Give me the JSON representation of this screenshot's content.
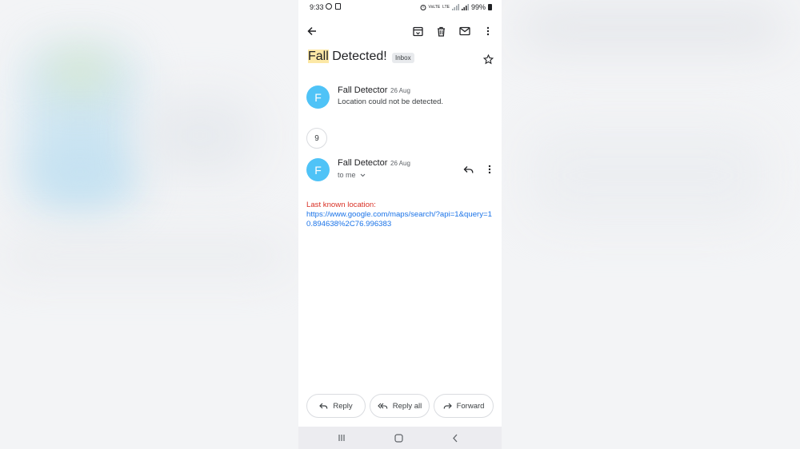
{
  "status_bar": {
    "time": "9:33",
    "battery": "99%",
    "signal_text_1": "VoLTE",
    "signal_text_2": "LTE"
  },
  "toolbar": {
    "back_icon": "arrow-left-icon",
    "archive_icon": "archive-icon",
    "delete_icon": "trash-icon",
    "mark_unread_icon": "mail-icon",
    "more_icon": "more-vert-icon"
  },
  "email": {
    "subject_highlight": "Fall",
    "subject_rest": " Detected!",
    "label": "Inbox"
  },
  "messages": [
    {
      "avatar_letter": "F",
      "sender": "Fall Detector",
      "date": "26 Aug",
      "snippet": "Location could not be detected."
    },
    {
      "avatar_letter": "F",
      "sender": "Fall Detector",
      "date": "26 Aug",
      "recipient": "to me"
    }
  ],
  "collapsed_count": "9",
  "body": {
    "label": "Last known location:",
    "link": "https://www.google.com/maps/search/?api=1&query=10.894638%2C76.996383"
  },
  "actions": {
    "reply": "Reply",
    "reply_all": "Reply all",
    "forward": "Forward"
  },
  "colors": {
    "avatar": "#4fc3f7",
    "highlight": "#fce8a6",
    "link": "#1a73e8",
    "alert_text": "#d93025"
  }
}
